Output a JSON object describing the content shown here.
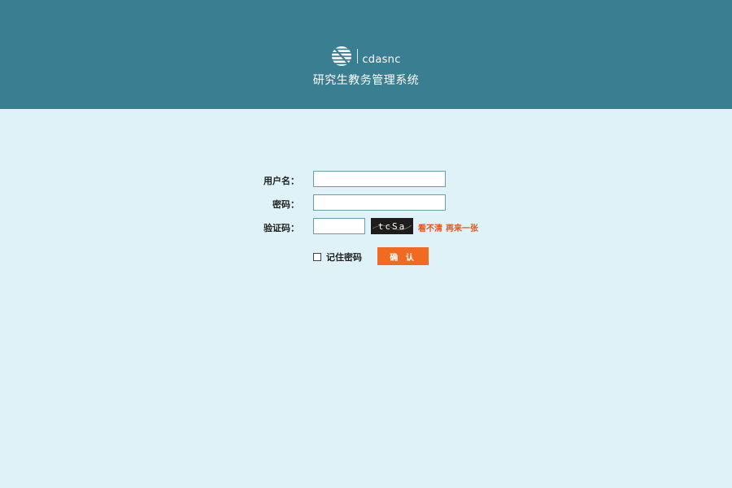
{
  "header": {
    "logo_icon": "globe-stripes-icon",
    "logo_text": "cdasnc",
    "system_title": "研究生教务管理系统",
    "background_color": "#3a7f91"
  },
  "login": {
    "username_label": "用户名：",
    "username_value": "",
    "password_label": "密码：",
    "password_value": "",
    "captcha_label": "验证码：",
    "captcha_value": "",
    "captcha_image_text": "tcSa",
    "captcha_refresh_1": "看不清",
    "captcha_refresh_2": "再来一张",
    "remember_label": "记住密码",
    "remember_checked": false,
    "submit_label": "确 认",
    "accent_color": "#f26a22",
    "link_color": "#e8541c"
  },
  "page": {
    "background_color": "#dff2f7"
  }
}
